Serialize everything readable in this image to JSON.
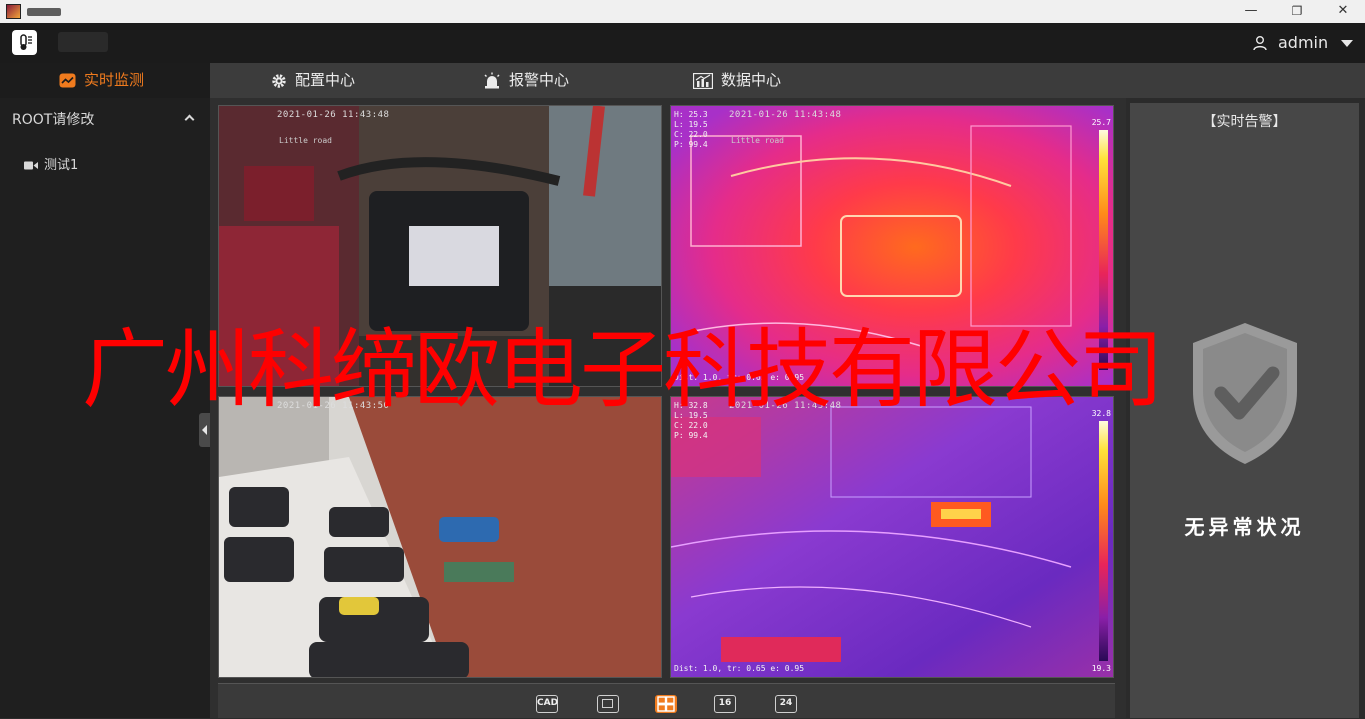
{
  "window": {
    "minimize_glyph": "—",
    "restore_glyph": "❐",
    "close_glyph": "✕"
  },
  "header": {
    "user_name": "admin"
  },
  "nav": {
    "tabs": [
      {
        "label": "实时监测",
        "icon": "chart-icon",
        "active": true
      },
      {
        "label": "配置中心",
        "icon": "gear-icon",
        "active": false
      },
      {
        "label": "报警中心",
        "icon": "alarm-icon",
        "active": false
      },
      {
        "label": "数据中心",
        "icon": "bar-chart-icon",
        "active": false
      }
    ]
  },
  "sidebar": {
    "root_label": "ROOT请修改",
    "items": [
      {
        "label": "测试1",
        "icon": "camera-icon"
      }
    ]
  },
  "video": {
    "cells": [
      {
        "type": "visible",
        "timestamp": "2021-01-26 11:43:48",
        "tag": "Little road"
      },
      {
        "type": "thermal",
        "timestamp": "2021-01-26 11:43:48",
        "tag": "Little road",
        "readout": [
          "H: 25.3",
          "L: 19.5",
          "C: 22.0",
          "P: 99.4"
        ],
        "footer": "Dist: 1.0, tr: 0.65 e: 0.95",
        "scale_max": "25.7",
        "scale_min": ""
      },
      {
        "type": "visible",
        "timestamp": "2021-01-26 11:43:50",
        "tag": ""
      },
      {
        "type": "thermal",
        "timestamp": "2021-01-26 11:43:48",
        "tag": "",
        "readout": [
          "H: 32.8",
          "L: 19.5",
          "C: 22.0",
          "P: 99.4"
        ],
        "footer": "Dist: 1.0, tr: 0.65 e: 0.95",
        "scale_max": "32.8",
        "scale_min": "19.3"
      }
    ]
  },
  "toolbar": {
    "buttons": [
      {
        "label": "CAD",
        "icon": "cad-icon",
        "active": false
      },
      {
        "label": "",
        "icon": "single-view-icon",
        "active": false
      },
      {
        "label": "",
        "icon": "quad-view-icon",
        "active": true
      },
      {
        "label": "16",
        "icon": "sixteen-view-icon",
        "active": false
      },
      {
        "label": "24",
        "icon": "twentyfour-view-icon",
        "active": false
      }
    ]
  },
  "alarm_panel": {
    "title": "【实时告警】",
    "status": "无异常状况"
  },
  "watermark": "广州科缔欧电子科技有限公司",
  "colors": {
    "accent": "#f07b1e",
    "watermark": "#ff0000",
    "nav_bg": "#3c3c3c",
    "sidebar_bg": "#1f1f1f"
  }
}
